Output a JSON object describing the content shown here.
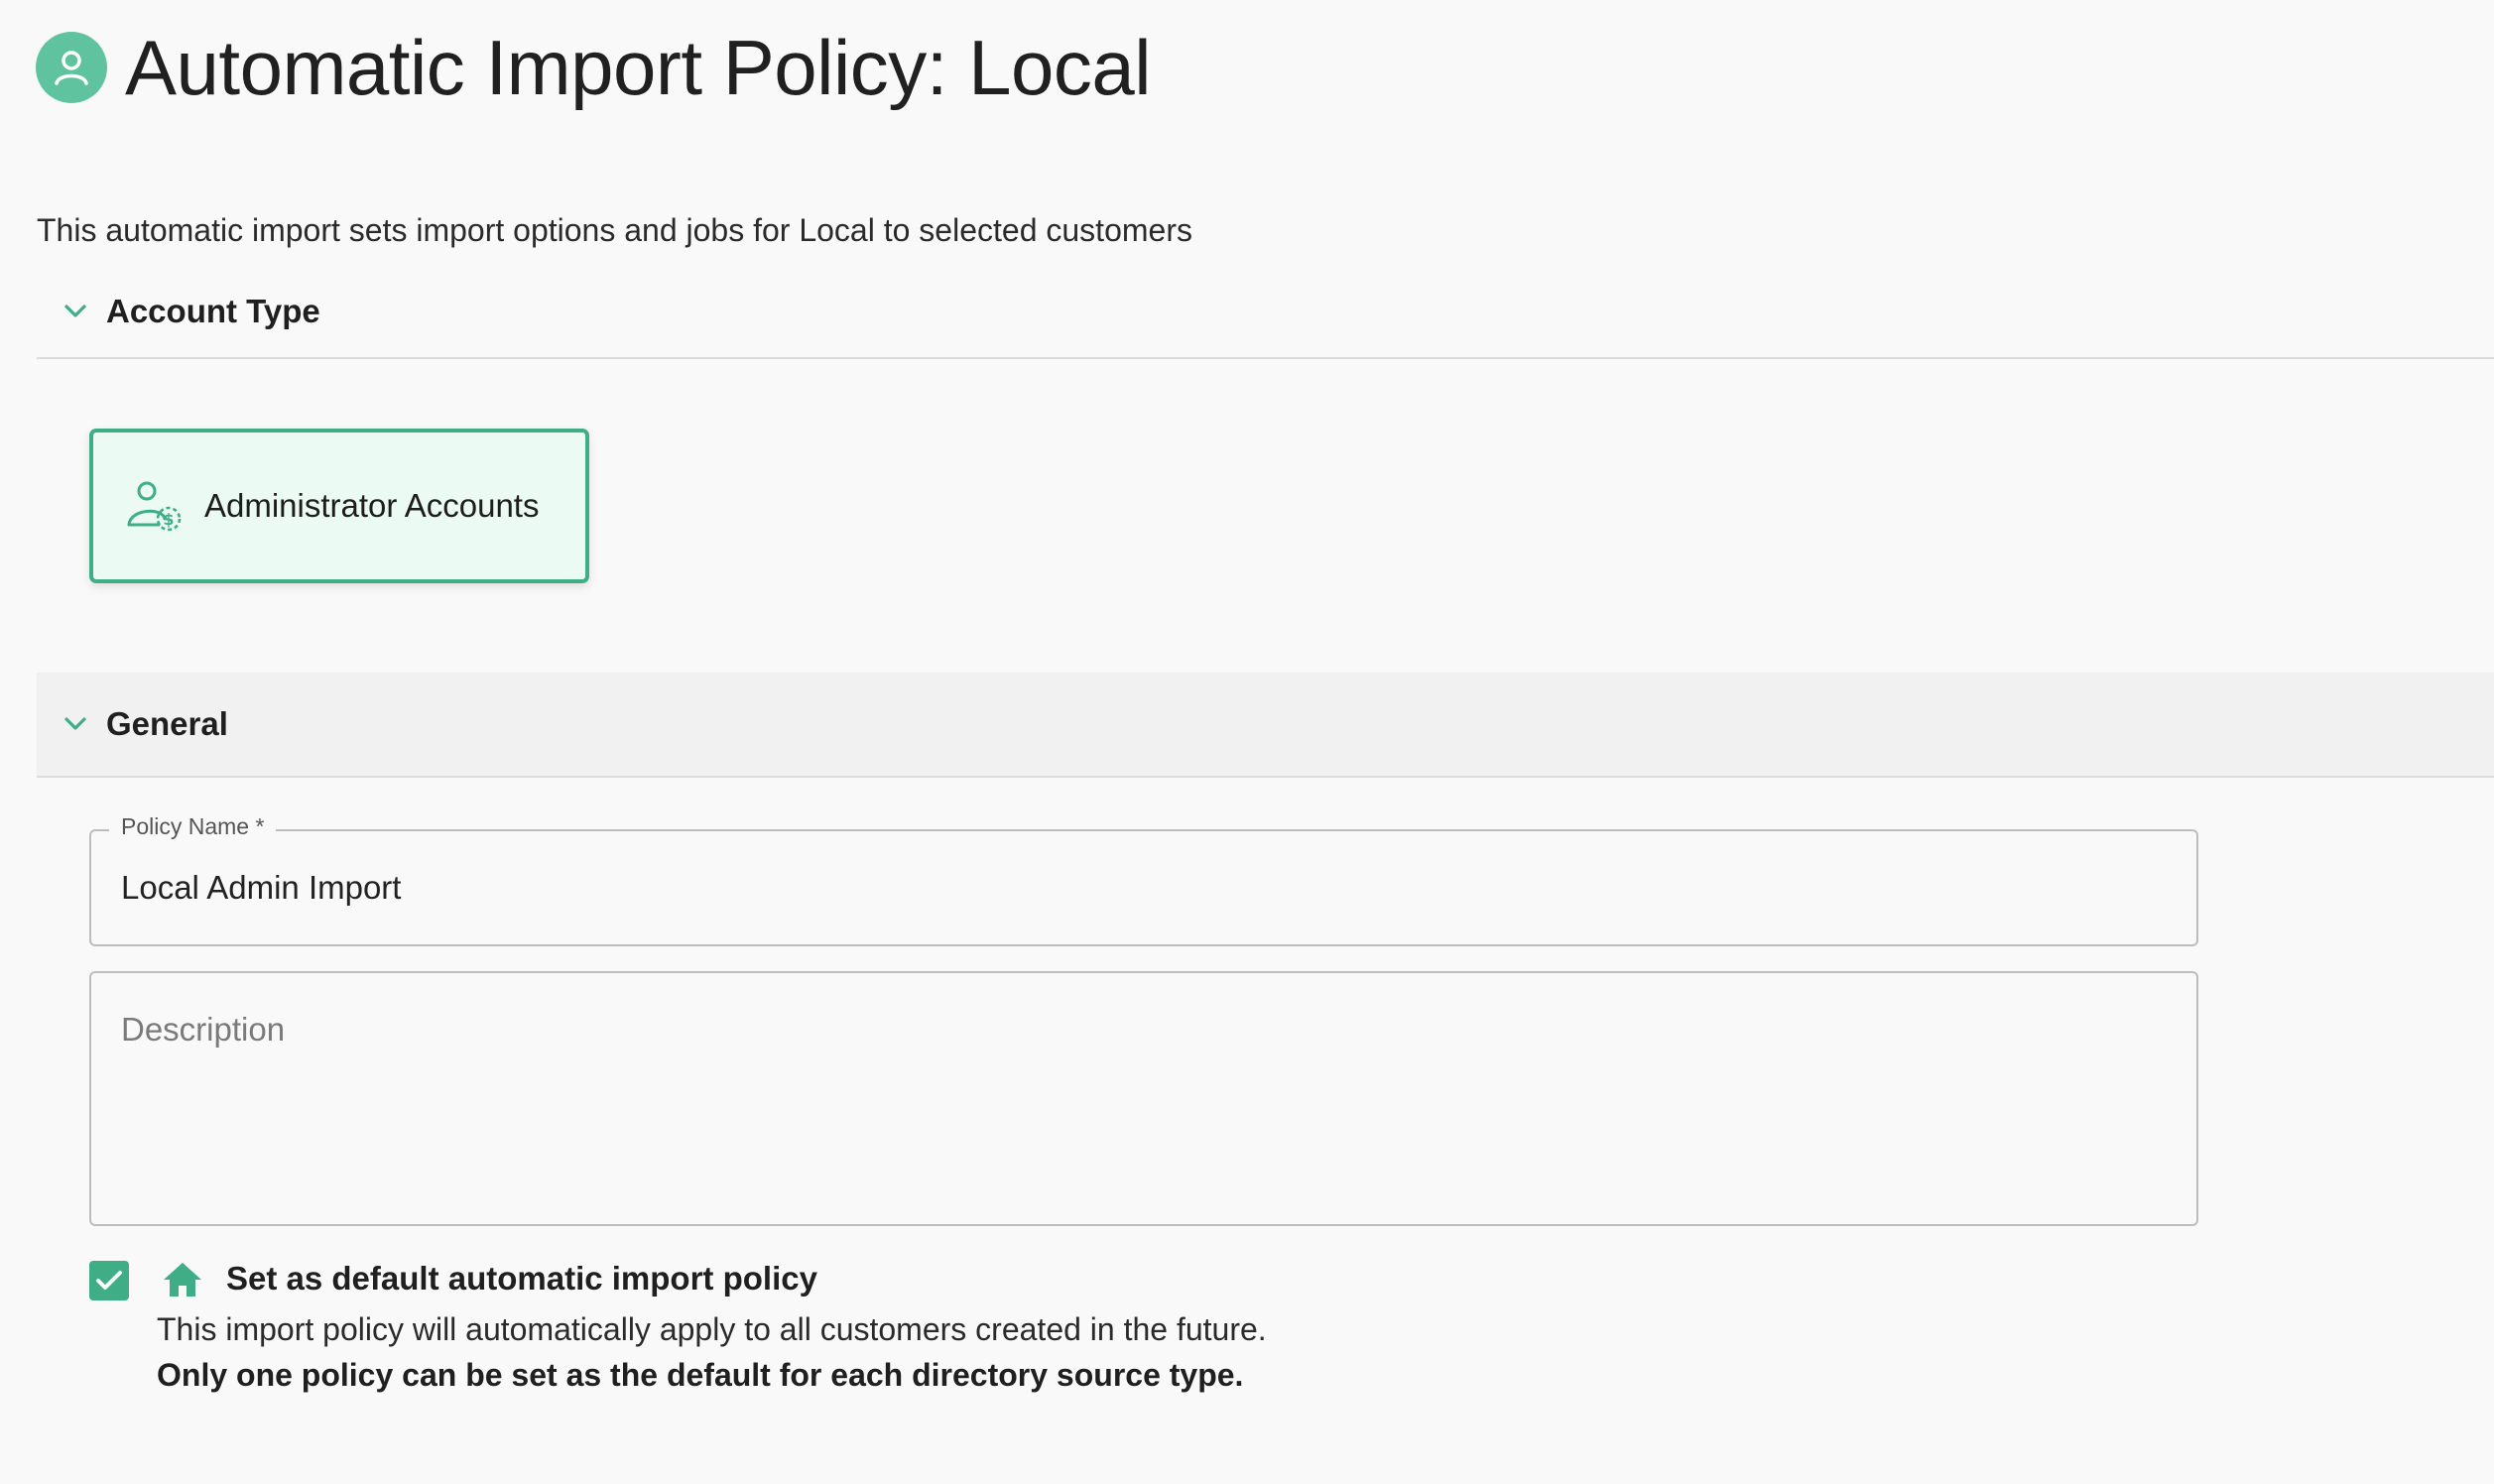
{
  "header": {
    "title": "Automatic Import Policy: Local",
    "icon": "user-avatar-icon"
  },
  "intro": {
    "text": "This automatic import sets import options and jobs for Local to selected customers"
  },
  "sections": {
    "account_type": {
      "label": "Account Type",
      "expanded": true,
      "card": {
        "label": "Administrator Accounts",
        "icon": "admin-accounts-icon",
        "selected": true
      }
    },
    "general": {
      "label": "General",
      "expanded": true
    }
  },
  "form": {
    "policy_name": {
      "label": "Policy Name *",
      "value": "Local Admin Import"
    },
    "description": {
      "placeholder": "Description",
      "value": ""
    },
    "default_policy": {
      "checked": true,
      "label": "Set as default automatic import policy",
      "note": "This import policy will automatically apply to all customers created in the future.",
      "warning": "Only one policy can be set as the default for each directory source type."
    }
  },
  "colors": {
    "accent": "#3fae87",
    "avatar": "#5fc3a0",
    "card_background": "#ebfbf4",
    "page_background": "#f9f9f9"
  }
}
